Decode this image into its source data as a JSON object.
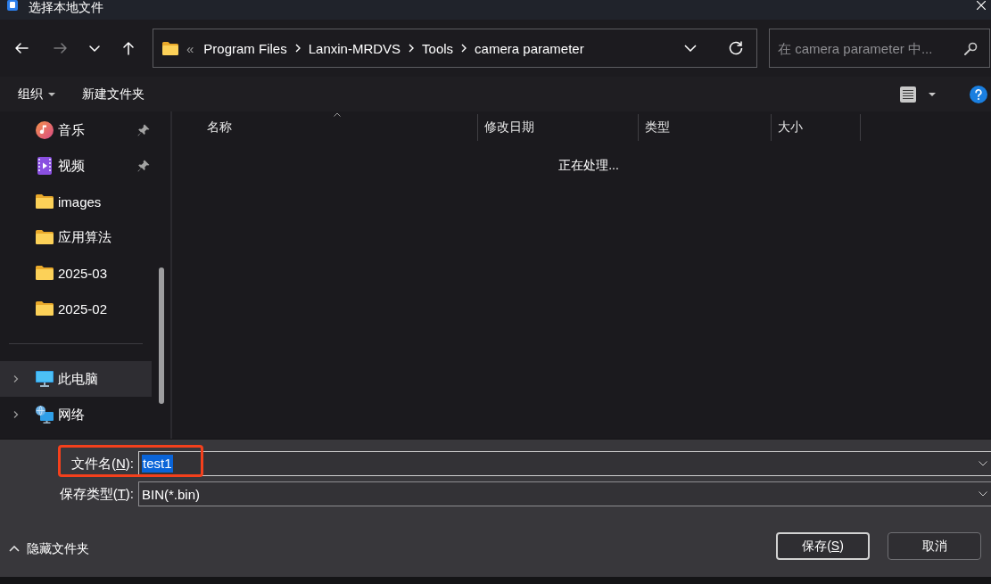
{
  "window": {
    "title": "选择本地文件"
  },
  "navigation": [
    {
      "kind": "back",
      "disabled": false
    },
    {
      "kind": "forward",
      "disabled": true
    },
    {
      "kind": "recent",
      "disabled": false
    },
    {
      "kind": "up",
      "disabled": false
    }
  ],
  "address_bar": {
    "overflow": "«",
    "path": [
      "Program Files",
      "Lanxin-MRDVS",
      "Tools",
      "camera parameter"
    ]
  },
  "search": {
    "placeholder": "在 camera parameter 中..."
  },
  "toolbar": [
    {
      "label": "组织",
      "has_menu": true
    },
    {
      "label": "新建文件夹",
      "has_menu": false
    }
  ],
  "sidebar": {
    "quick_access": [
      {
        "label": "音乐",
        "kind": "music",
        "pinned": true,
        "selected": false
      },
      {
        "label": "视频",
        "kind": "video",
        "pinned": true,
        "selected": false
      },
      {
        "label": "images",
        "kind": "folder",
        "pinned": false,
        "selected": false
      },
      {
        "label": "应用算法",
        "kind": "folder",
        "pinned": false,
        "selected": false
      },
      {
        "label": "2025-03",
        "kind": "folder",
        "pinned": false,
        "selected": false
      },
      {
        "label": "2025-02",
        "kind": "folder",
        "pinned": false,
        "selected": false
      }
    ],
    "locations": [
      {
        "label": "此电脑",
        "kind": "pc",
        "expanded": false,
        "selected": true
      },
      {
        "label": "网络",
        "kind": "network",
        "expanded": false,
        "selected": false
      }
    ]
  },
  "file_list": {
    "columns": [
      {
        "label": "名称",
        "sorted": true
      },
      {
        "label": "修改日期",
        "sorted": false
      },
      {
        "label": "类型",
        "sorted": false
      },
      {
        "label": "大小",
        "sorted": false
      }
    ],
    "status": "正在处理..."
  },
  "file_name": {
    "label": {
      "text_before": "文件名(",
      "access_key": "N",
      "text_after": "):"
    },
    "value": "test1",
    "value_selected": true,
    "highlighted": true
  },
  "file_type": {
    "label": {
      "text_before": "保存类型(",
      "access_key": "T",
      "text_after": "):"
    },
    "value": "BIN(*.bin)"
  },
  "hide_folders": "隐藏文件夹",
  "buttons": [
    {
      "label": {
        "text_before": "保存(",
        "access_key": "S",
        "text_after": ")"
      },
      "default": true
    },
    {
      "label": {
        "text_before": "取消"
      },
      "default": false
    }
  ]
}
